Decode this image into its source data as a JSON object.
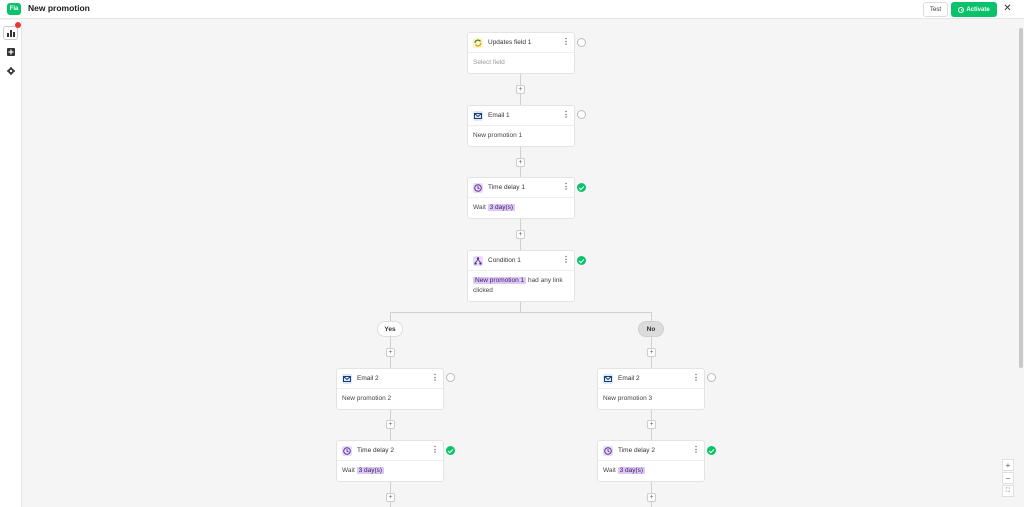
{
  "app": {
    "logo": "Fla",
    "title": "New promotion"
  },
  "header": {
    "test_label": "Test",
    "activate_label": "Activate",
    "close_label": "✕"
  },
  "rail": {
    "items": [
      "analytics-icon",
      "add-block-icon",
      "settings-icon"
    ]
  },
  "flow": {
    "updates": {
      "title": "Updates field 1",
      "body": "Select field"
    },
    "email1": {
      "title": "Email 1",
      "body": "New promotion 1"
    },
    "delay1": {
      "title": "Time delay 1",
      "wait": "Wait",
      "value": "3 day(s)"
    },
    "condition1": {
      "title": "Condition 1",
      "highlight": "New promotion 1",
      "rest": "had any link clicked"
    },
    "branches": {
      "yes": "Yes",
      "no": "No"
    },
    "email2": {
      "title": "Email 2",
      "body": "New promotion 2"
    },
    "email3": {
      "title": "Email 2",
      "body": "New promotion 3"
    },
    "delay2": {
      "title": "Time delay 2",
      "wait": "Wait",
      "value": "3 day(s)"
    },
    "delay3": {
      "title": "Time delay 2",
      "wait": "Wait",
      "value": "3 day(s)"
    }
  },
  "zoom": {
    "in": "+",
    "out": "−",
    "fit": "⛶"
  },
  "colors": {
    "accent": "#09c269",
    "highlight": "#ddc8f5",
    "canvas": "#f5f5f5"
  }
}
